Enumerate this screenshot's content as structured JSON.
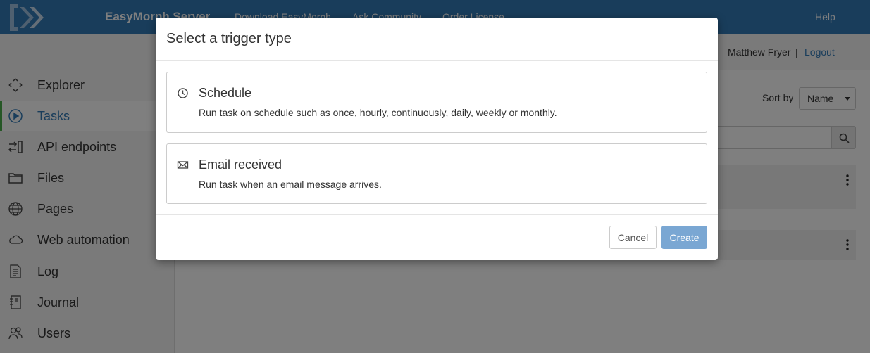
{
  "app": {
    "brand": "EasyMorph Server"
  },
  "nav": {
    "links": [
      "Download EasyMorph",
      "Ask Community",
      "Order License"
    ],
    "help": "Help"
  },
  "user": {
    "name": "Matthew Fryer",
    "separator": "|",
    "logout": "Logout"
  },
  "sidebar": {
    "items": [
      {
        "label": "Explorer",
        "icon": "explorer-icon"
      },
      {
        "label": "Tasks",
        "icon": "play-circle-icon",
        "active": true
      },
      {
        "label": "API endpoints",
        "icon": "api-endpoints-icon"
      },
      {
        "label": "Files",
        "icon": "folder-icon"
      },
      {
        "label": "Pages",
        "icon": "globe-icon"
      },
      {
        "label": "Web automation",
        "icon": "cloud-icon"
      },
      {
        "label": "Log",
        "icon": "log-icon"
      },
      {
        "label": "Journal",
        "icon": "journal-icon"
      },
      {
        "label": "Users",
        "icon": "users-icon"
      }
    ]
  },
  "toolbar": {
    "sort_label": "Sort by",
    "sort_value": "Name"
  },
  "modal": {
    "title": "Select a trigger type",
    "options": [
      {
        "title": "Schedule",
        "description": "Run task on schedule such as once, hourly, continuously, daily, weekly or monthly.",
        "icon": "clock-icon"
      },
      {
        "title": "Email received",
        "description": "Run task when an email message arrives.",
        "icon": "envelope-icon"
      }
    ],
    "cancel_label": "Cancel",
    "create_label": "Create"
  },
  "colors": {
    "navbar": "#337ab7",
    "active_accent": "#4cae4c",
    "link": "#337ab7",
    "create_button": "#7aa7d3"
  }
}
